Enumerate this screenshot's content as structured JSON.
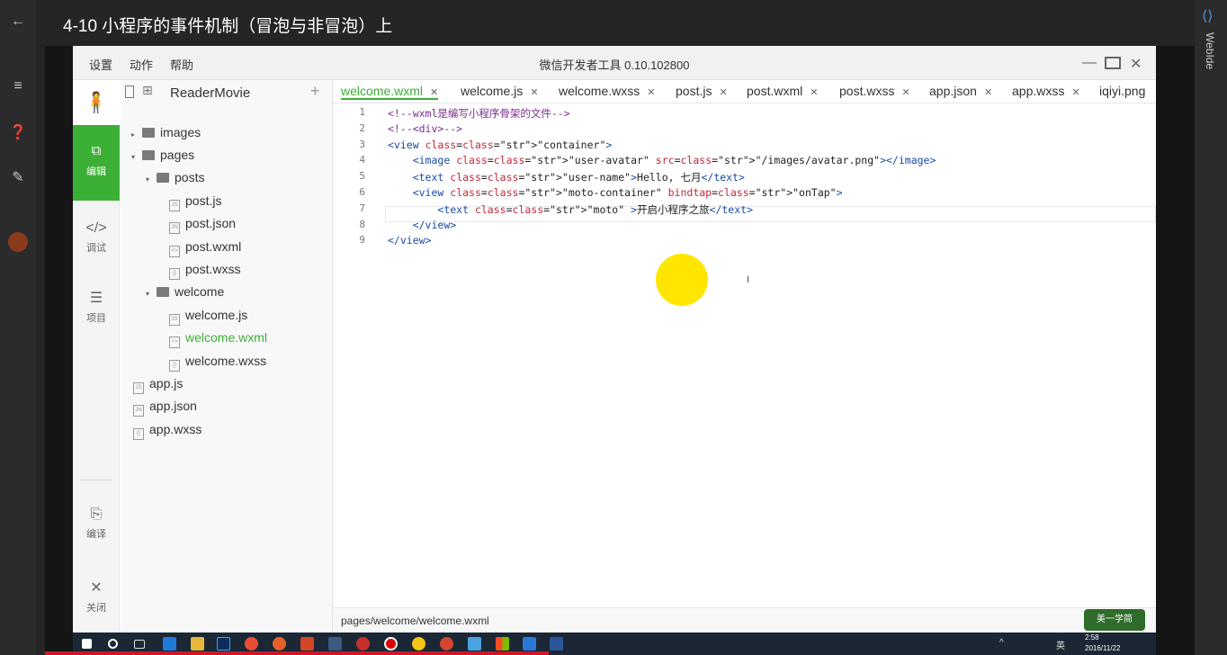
{
  "video": {
    "title": "4-10 小程序的事件机制（冒泡与非冒泡）上",
    "brand": "WebIde"
  },
  "app": {
    "title": "微信开发者工具 0.10.102800",
    "menu": [
      "设置",
      "动作",
      "帮助"
    ],
    "toolbar": {
      "edit": "编辑",
      "debug": "调试",
      "project": "项目",
      "compile": "编译",
      "close": "关闭"
    },
    "project_name": "ReaderMovie"
  },
  "tree": [
    {
      "label": "images",
      "type": "folder",
      "depth": 0,
      "arrow": "▸"
    },
    {
      "label": "pages",
      "type": "folder",
      "depth": 0,
      "arrow": "▾"
    },
    {
      "label": "posts",
      "type": "folder",
      "depth": 1,
      "arrow": "▾"
    },
    {
      "label": "post.js",
      "type": "file",
      "icon": "JS",
      "depth": 2
    },
    {
      "label": "post.json",
      "type": "file",
      "icon": "JN",
      "depth": 2
    },
    {
      "label": "post.wxml",
      "type": "file",
      "icon": "<>",
      "depth": 2
    },
    {
      "label": "post.wxss",
      "type": "file",
      "icon": "{}",
      "depth": 2
    },
    {
      "label": "welcome",
      "type": "folder",
      "depth": 1,
      "arrow": "▾"
    },
    {
      "label": "welcome.js",
      "type": "file",
      "icon": "JS",
      "depth": 2
    },
    {
      "label": "welcome.wxml",
      "type": "file",
      "icon": "<>",
      "depth": 2,
      "active": true
    },
    {
      "label": "welcome.wxss",
      "type": "file",
      "icon": "{}",
      "depth": 2
    },
    {
      "label": "app.js",
      "type": "file",
      "icon": "JS",
      "depth": 0
    },
    {
      "label": "app.json",
      "type": "file",
      "icon": "JN",
      "depth": 0
    },
    {
      "label": "app.wxss",
      "type": "file",
      "icon": "{}",
      "depth": 0
    }
  ],
  "tabs": [
    "welcome.wxml",
    "welcome.js",
    "welcome.wxss",
    "post.js",
    "post.wxml",
    "post.wxss",
    "app.json",
    "app.wxss",
    "iqiyi.png"
  ],
  "code_lines": [
    "<!--wxml是编写小程序骨架的文件-->",
    "<!--<div>-->",
    "<view class=\"container\">",
    "    <image class=\"user-avatar\" src=\"/images/avatar.png\"></image>",
    "    <text class=\"user-name\">Hello, 七月</text>",
    "    <view class=\"moto-container\" bindtap=\"onTap\">",
    "        <text class=\"moto\" >开启小程序之旅</text>",
    "    </view>",
    "</view>"
  ],
  "status_path": "pages/welcome/welcome.wxml",
  "taskbar": {
    "time": "2:58",
    "date": "2016/11/22",
    "lang": "英"
  },
  "watermark": "美一学简",
  "colors": {
    "accent": "#3cb035",
    "cursor_highlight": "#ffe600"
  }
}
